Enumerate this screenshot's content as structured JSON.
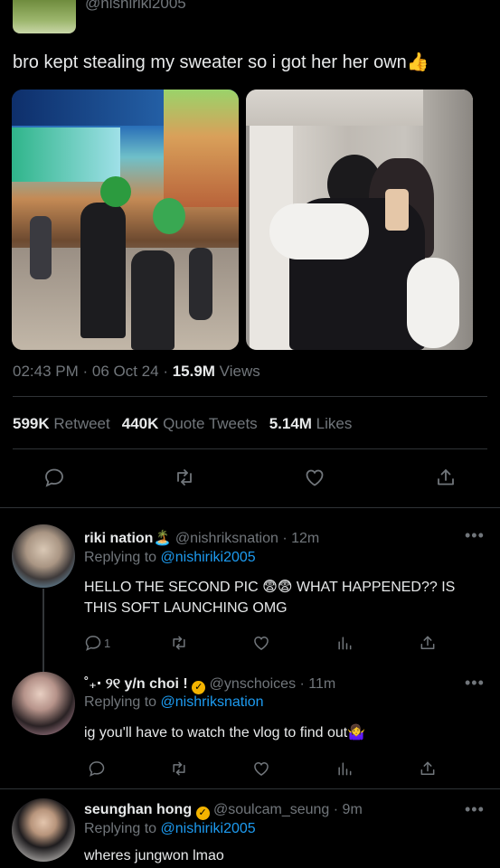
{
  "top": {
    "handle": "@nishiriki2005"
  },
  "tweet": {
    "text": "bro kept stealing my sweater so i got her her own👍",
    "time": "02:43 PM",
    "date": "06 Oct 24",
    "sep1": " · ",
    "sep2": " · ",
    "views_count": "15.9M",
    "views_label": " Views",
    "stats": {
      "retweets_count": "599K",
      "retweets_label": " Retweet",
      "quotes_count": "440K",
      "quotes_label": " Quote Tweets",
      "likes_count": "5.14M",
      "likes_label": " Likes"
    }
  },
  "replies": [
    {
      "name": "riki nation🏝️",
      "handle": "@nishriksnation",
      "time": "· 12m",
      "replying_prefix": "Replying to ",
      "replying_to": "@nishiriki2005",
      "text": "HELLO THE SECOND PIC 😨😨 WHAT HAPPENED?? IS THIS SOFT LAUNCHING OMG",
      "reply_count": "1"
    },
    {
      "name": "˚₊‧ ୨୧ y/n choi !",
      "handle": "@ynschoices",
      "time": "· 11m",
      "replying_prefix": "Replying to ",
      "replying_to": "@nishriksnation",
      "text": "ig you'll have to watch the vlog to find out🤷‍♀️"
    },
    {
      "name": "seunghan hong",
      "handle": "@soulcam_seung",
      "time": "· 9m",
      "replying_prefix": "Replying to ",
      "replying_to": "@nishiriki2005",
      "text": "wheres jungwon lmao"
    }
  ],
  "icons": {
    "reply": "reply-icon",
    "retweet": "retweet-icon",
    "like": "heart-icon",
    "share": "share-icon",
    "views": "analytics-icon",
    "more": "more-icon",
    "verified": "verified-badge-icon"
  },
  "colors": {
    "background": "#000000",
    "text": "#e7e9ea",
    "muted": "#71767b",
    "link": "#1d9bf0",
    "divider": "#2f3336",
    "verified": "#f4b400"
  }
}
